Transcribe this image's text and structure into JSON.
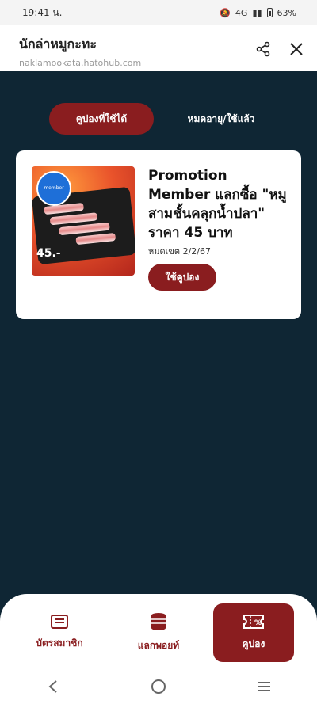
{
  "status_bar": {
    "time": "19:41 น.",
    "network": "4G",
    "battery": "63%"
  },
  "header": {
    "title": "นักล่าหมูกะทะ",
    "url": "naklamookata.hatohub.com",
    "share_icon": "share-icon",
    "close_icon": "close-icon"
  },
  "tabs": [
    {
      "label": "คูปองที่ใช้ได้",
      "active": true
    },
    {
      "label": "หมดอายุ/ใช้แล้ว",
      "active": false
    }
  ],
  "coupon": {
    "title": "Promotion Member แลกซื้อ \"หมูสามชั้นคลุกน้ำปลา\" ราคา 45 บาท",
    "expiry": "หมดเขต 2/2/67",
    "button_label": "ใช้คูปอง",
    "image": {
      "badge_text": "member",
      "price_text": "45.-"
    }
  },
  "bottom_nav": [
    {
      "label": "บัตรสมาชิก",
      "icon": "member-card-icon",
      "active": false
    },
    {
      "label": "แลกพอยท์",
      "icon": "coins-icon",
      "active": false
    },
    {
      "label": "คูปอง",
      "icon": "coupon-icon",
      "active": true
    }
  ],
  "colors": {
    "background": "#0f2634",
    "accent": "#8a1d1f",
    "card": "#ffffff"
  }
}
